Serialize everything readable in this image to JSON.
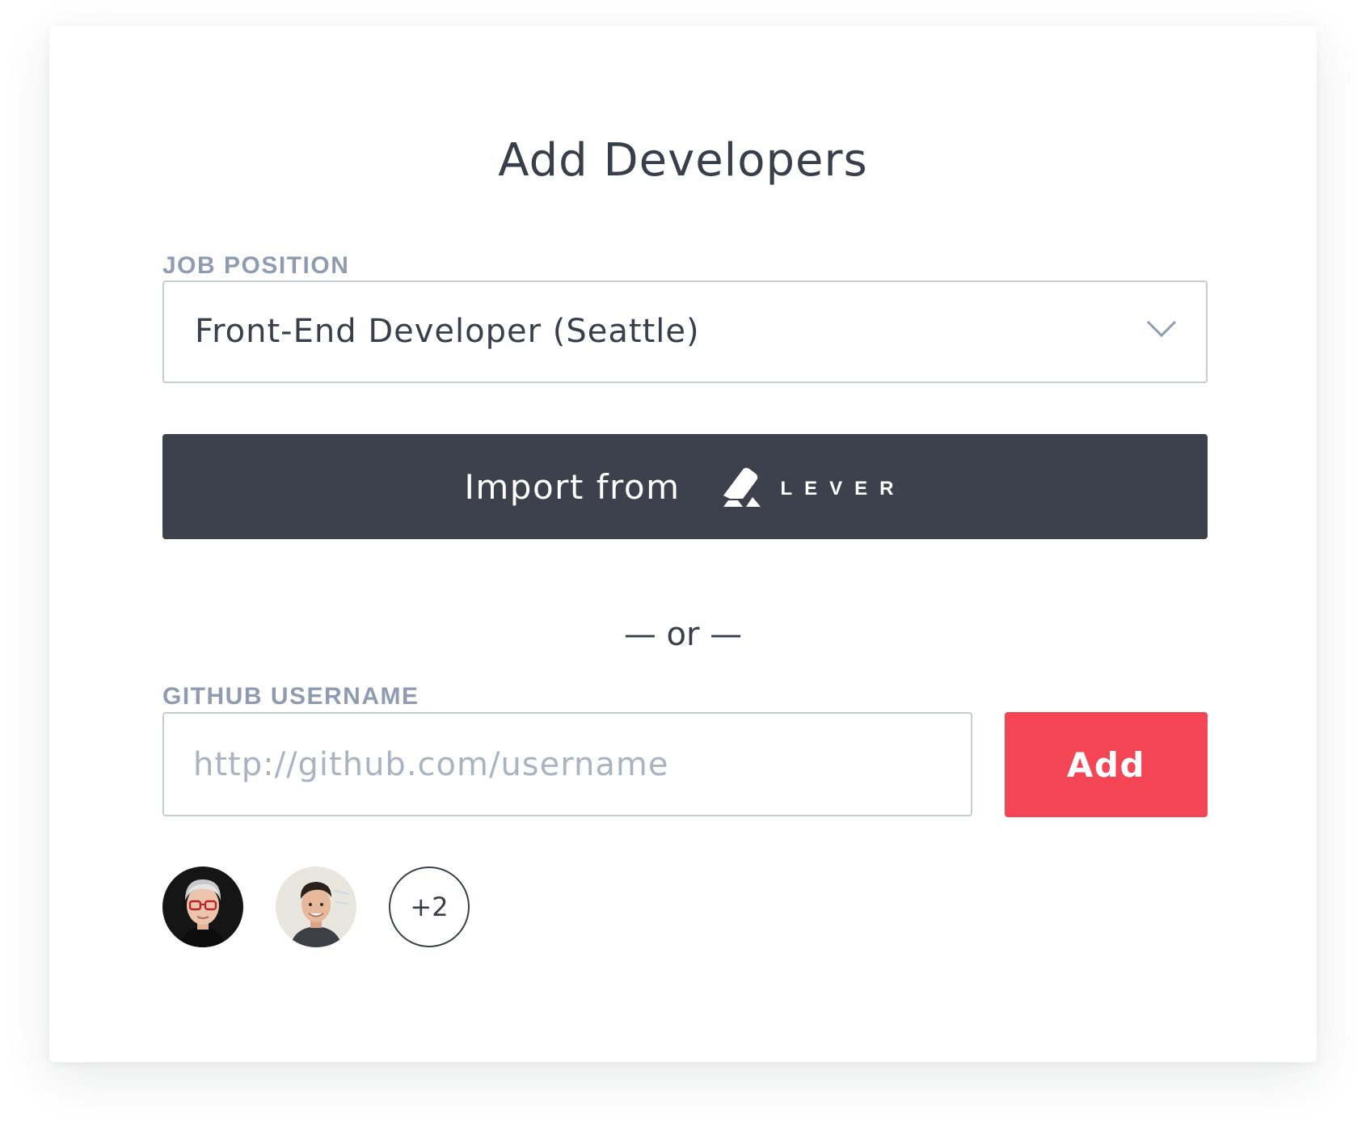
{
  "dialog": {
    "title": "Add Developers"
  },
  "job_position": {
    "label": "JOB POSITION",
    "selected": "Front-End Developer (Seattle)"
  },
  "import": {
    "label": "Import from",
    "brand": "LEVER"
  },
  "separator": {
    "text": "— or —"
  },
  "github": {
    "label": "GITHUB USERNAME",
    "placeholder": "http://github.com/username",
    "value": "",
    "add_label": "Add"
  },
  "added_developers": {
    "avatars": [
      {
        "icon": "developer-avatar-1"
      },
      {
        "icon": "developer-avatar-2"
      }
    ],
    "more_count": "+2"
  },
  "colors": {
    "primary_dark": "#3c414c",
    "accent_red": "#f44556",
    "label_gray": "#8f9cb0",
    "text_dark": "#383f4b",
    "border": "#c4ccd6"
  }
}
